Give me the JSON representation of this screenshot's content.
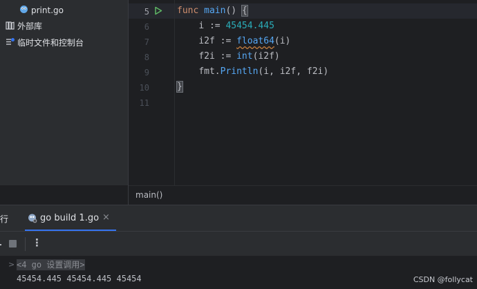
{
  "sidebar": {
    "items": [
      {
        "label": "print.go",
        "icon": "go-file-icon"
      },
      {
        "label": "外部库",
        "icon": "library-icon"
      },
      {
        "label": "临时文件和控制台",
        "icon": "scratches-icon"
      }
    ]
  },
  "editor": {
    "line_numbers": [
      "5",
      "6",
      "7",
      "8",
      "9",
      "10",
      "11"
    ],
    "code": {
      "l5": {
        "kw": "func",
        "fn": "main",
        "rest": "() ",
        "brace": "{"
      },
      "l6": {
        "lhs": "i := ",
        "num": "45454.445"
      },
      "l7": {
        "lhs": "i2f := ",
        "fn": "float64",
        "rest": "(i)"
      },
      "l8": {
        "lhs": "f2i := ",
        "fn": "int",
        "rest": "(i2f)"
      },
      "l9": {
        "pkg": "fmt.",
        "fn": "Println",
        "rest": "(i, i2f, f2i)"
      },
      "l10": {
        "brace": "}"
      }
    },
    "breadcrumb": "main()"
  },
  "tool_window": {
    "title": "行",
    "tab_label": "go build 1.go",
    "close_glyph": "×",
    "more_glyph": "⋮"
  },
  "console": {
    "chevron": ">",
    "command_hint": "<4 go 设置调用>",
    "output": "45454.445 45454.445 45454"
  },
  "watermark": "CSDN @follycat",
  "colors": {
    "accent": "#3574f0",
    "keyword": "#cf8e6d",
    "function": "#56a8f5",
    "number": "#2aacb8",
    "run_green": "#5fb865"
  }
}
